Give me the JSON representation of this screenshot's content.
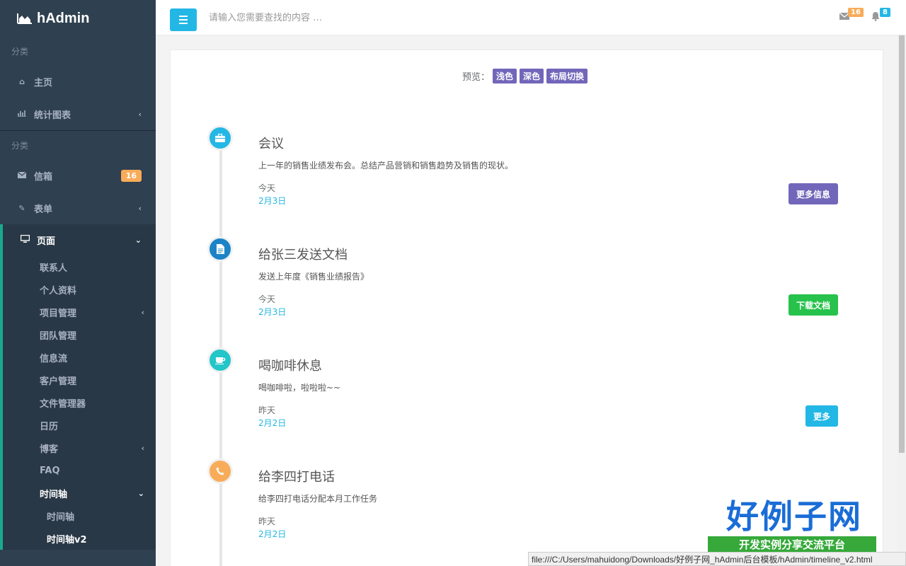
{
  "sidebar": {
    "brand": "hAdmin",
    "section1": "分类",
    "home": "主页",
    "charts": "统计图表",
    "section2": "分类",
    "mailbox": "信箱",
    "mailbox_badge": "16",
    "forms": "表单",
    "pages": "页面",
    "page_items": {
      "contacts": "联系人",
      "profile": "个人资料",
      "projects": "项目管理",
      "teams": "团队管理",
      "feed": "信息流",
      "clients": "客户管理",
      "files": "文件管理器",
      "calendar": "日历",
      "blog": "博客",
      "faq": "FAQ",
      "timeline": "时间轴"
    },
    "timeline_items": {
      "timeline": "时间轴",
      "timeline_v2": "时间轴v2"
    }
  },
  "topbar": {
    "search_placeholder": "请输入您需要查找的内容 …",
    "mail_count": "16",
    "notify_count": "8"
  },
  "preview": {
    "label": "预览：",
    "light": "浅色",
    "dark": "深色",
    "layout": "布局切换"
  },
  "timeline": [
    {
      "title": "会议",
      "desc": "上一年的销售业绩发布会。总结产品营销和销售趋势及销售的现状。",
      "day": "今天",
      "date": "2月3日",
      "button": "更多信息",
      "icon": "briefcase-icon"
    },
    {
      "title": "给张三发送文档",
      "desc": "发送上年度《销售业绩报告》",
      "day": "今天",
      "date": "2月3日",
      "button": "下载文档",
      "icon": "file-icon"
    },
    {
      "title": "喝咖啡休息",
      "desc": "喝咖啡啦，啦啦啦~~",
      "day": "昨天",
      "date": "2月2日",
      "button": "更多",
      "icon": "coffee-icon"
    },
    {
      "title": "给李四打电话",
      "desc": "给李四打电话分配本月工作任务",
      "day": "昨天",
      "date": "2月2日",
      "icon": "phone-icon"
    }
  ],
  "colors": {
    "sidebar_bg": "#2f4050",
    "accent_blue": "#23b7e5",
    "purple": "#7266ba",
    "green": "#27c24c",
    "orange": "#f8ac59",
    "active_border": "#19aa8d"
  },
  "status_url": "file:///C:/Users/mahuidong/Downloads/好例子网_hAdmin后台模板/hAdmin/timeline_v2.html",
  "watermark": {
    "title": "好例子网",
    "subtitle": "开发实例分享交流平台"
  }
}
